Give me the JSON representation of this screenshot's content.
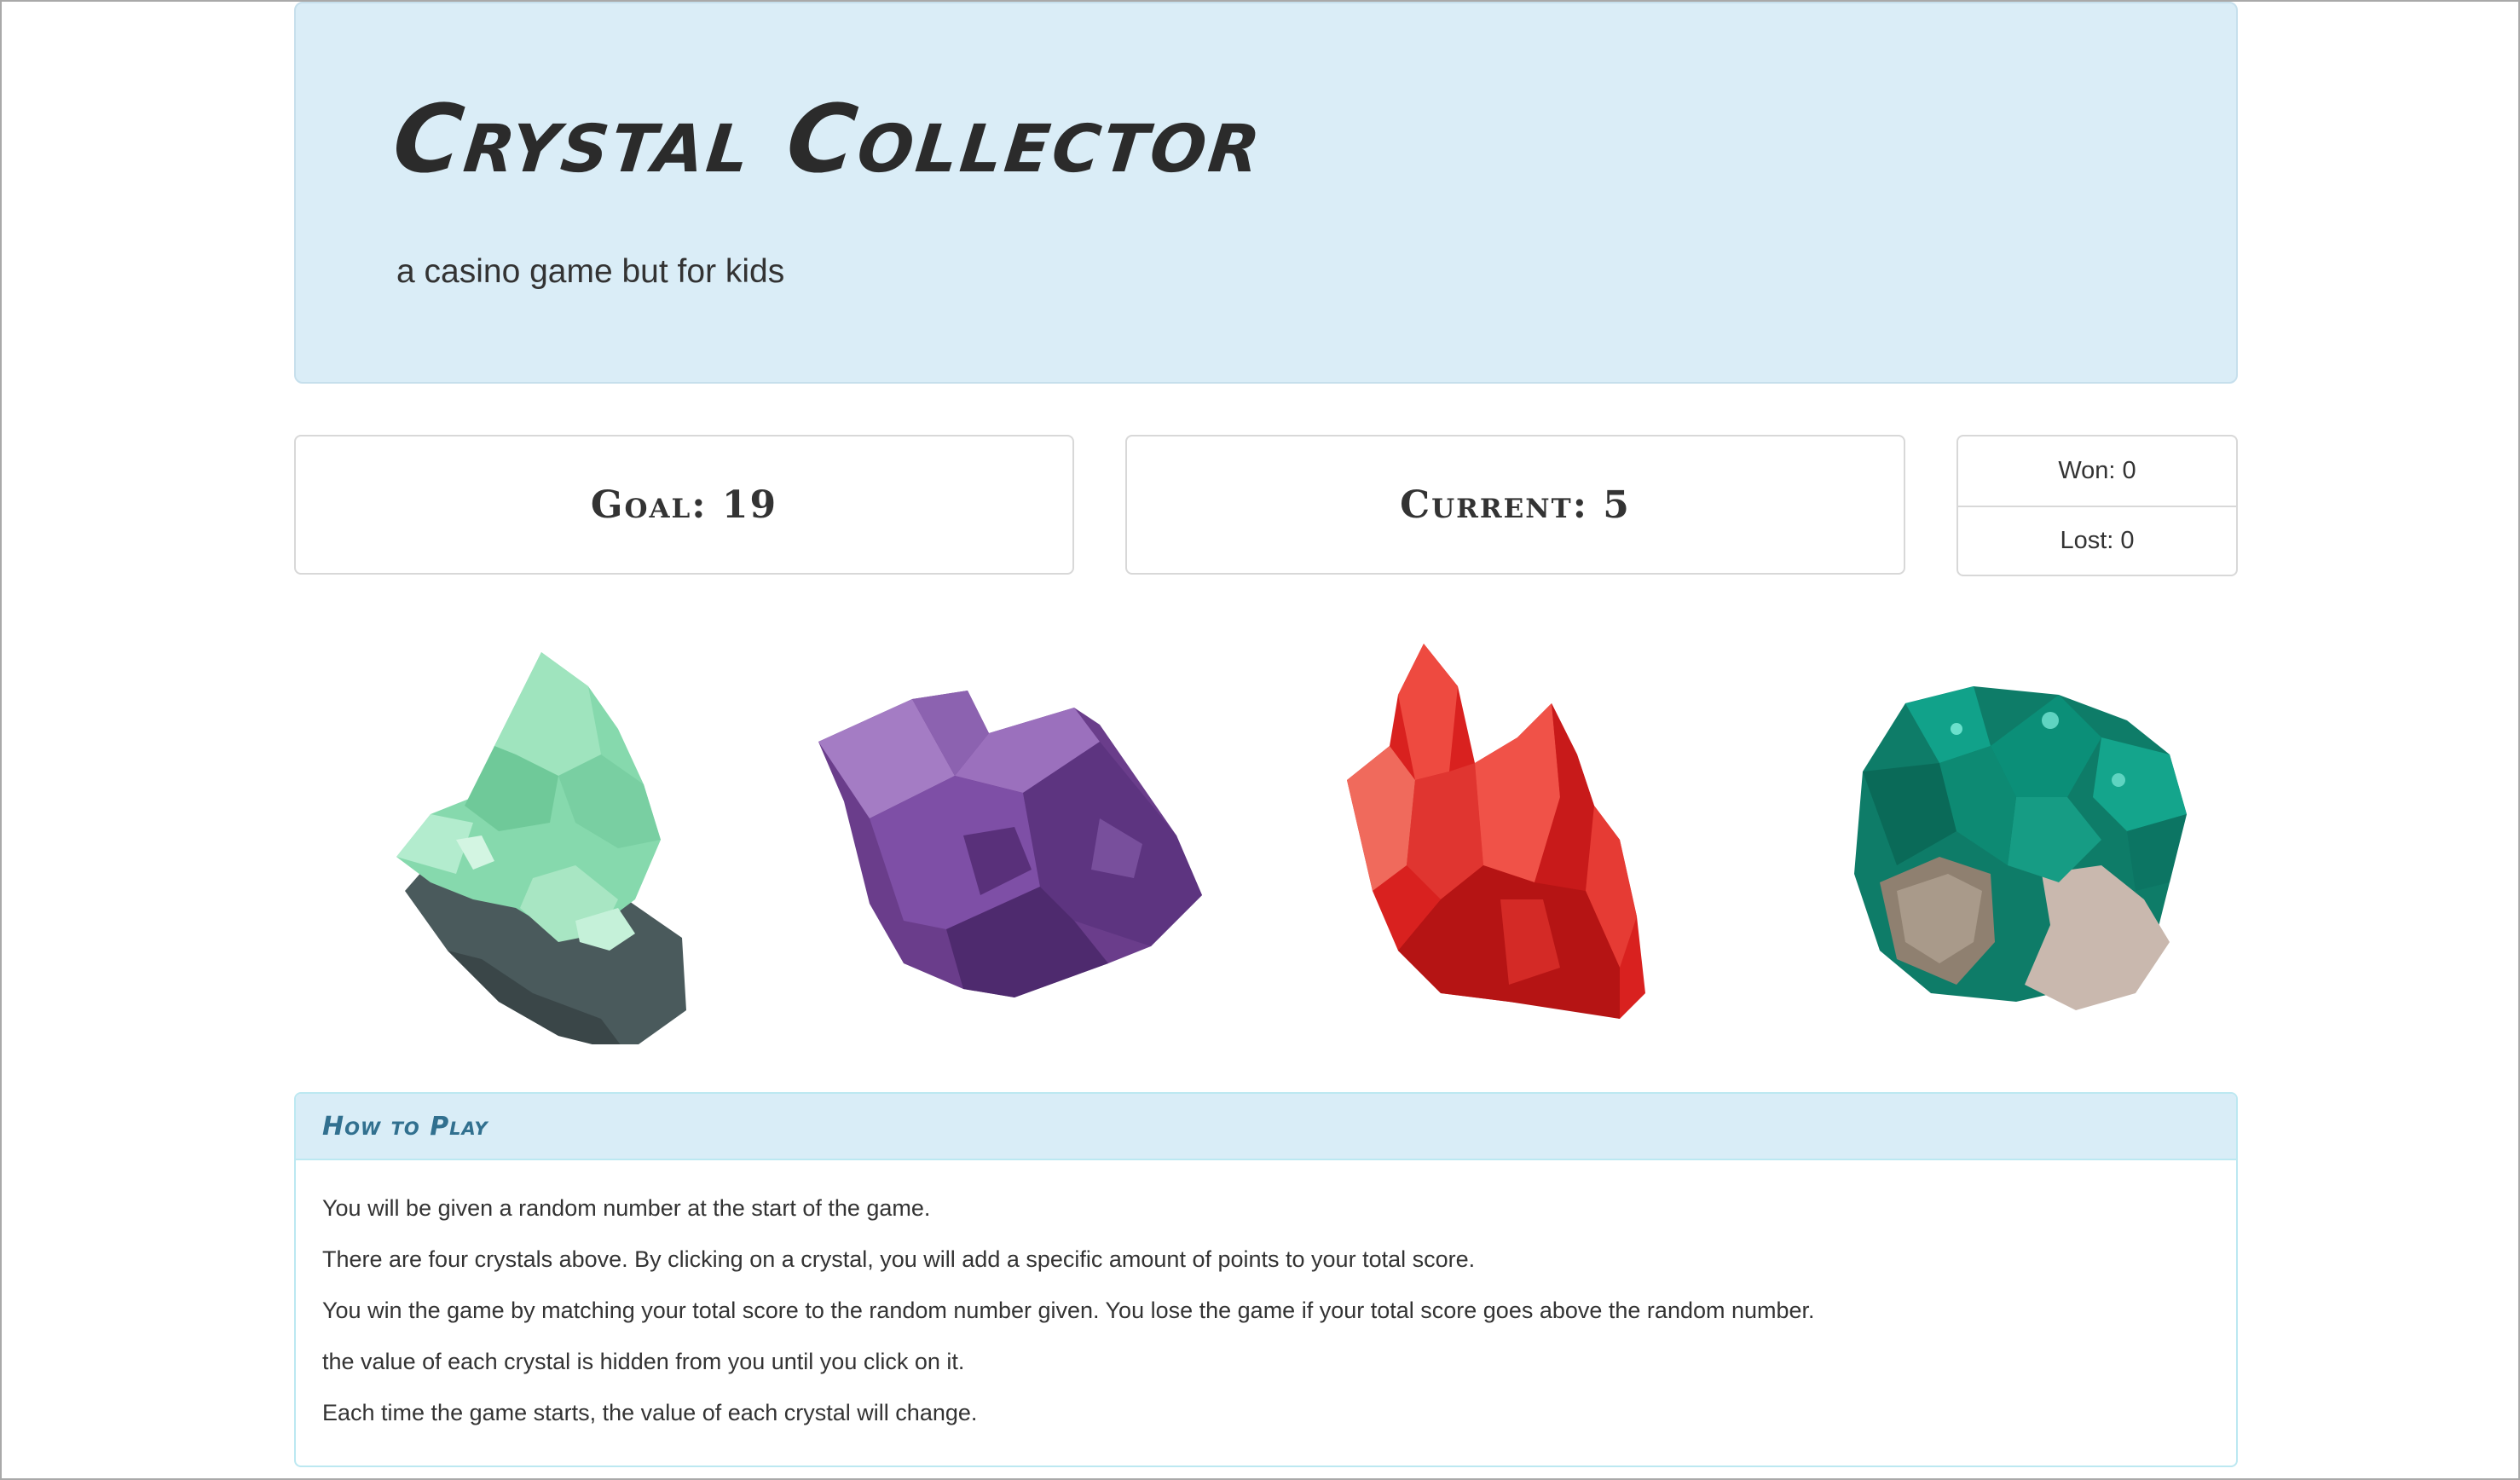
{
  "header": {
    "title": "Crystal Collector",
    "subtitle": "a casino game but for kids"
  },
  "scores": {
    "goal_label": "Goal: 19",
    "goal": 19,
    "current_label": "Current: 5",
    "current": 5,
    "won_label": "Won: 0",
    "lost_label": "Lost: 0"
  },
  "crystals": [
    {
      "name": "green-crystal-image",
      "color": "#7fd6a8"
    },
    {
      "name": "purple-crystal-image",
      "color": "#7a4f98"
    },
    {
      "name": "red-crystal-image",
      "color": "#e0302c"
    },
    {
      "name": "teal-crystal-image",
      "color": "#0f8a74"
    }
  ],
  "how_to_play": {
    "title": "How to Play",
    "lines": [
      "You will be given a random number at the start of the game.",
      "There are four crystals above. By clicking on a crystal, you will add a specific amount of points to your total score.",
      "You win the game by matching your total score to the random number given. You lose the game if your total score goes above the random number.",
      "the value of each crystal is hidden from you until you click on it.",
      "Each time the game starts, the value of each crystal will change."
    ]
  }
}
